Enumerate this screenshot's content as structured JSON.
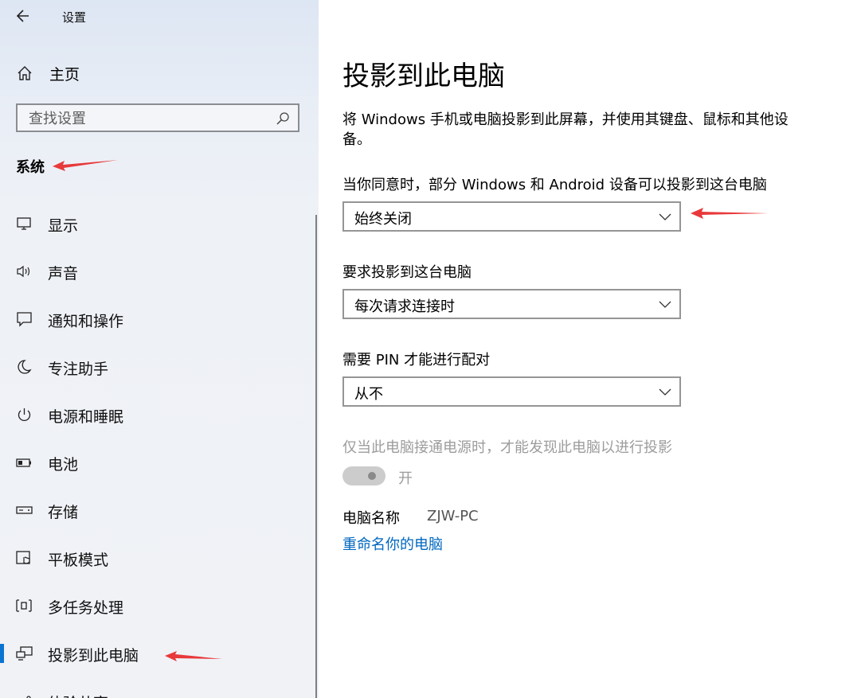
{
  "window": {
    "title": "设置"
  },
  "sidebar": {
    "home_label": "主页",
    "search_placeholder": "查找设置",
    "section_title": "系统",
    "items": [
      {
        "label": "显示",
        "icon": "monitor-icon"
      },
      {
        "label": "声音",
        "icon": "speaker-icon"
      },
      {
        "label": "通知和操作",
        "icon": "notification-icon"
      },
      {
        "label": "专注助手",
        "icon": "moon-icon"
      },
      {
        "label": "电源和睡眠",
        "icon": "power-icon"
      },
      {
        "label": "电池",
        "icon": "battery-icon"
      },
      {
        "label": "存储",
        "icon": "storage-icon"
      },
      {
        "label": "平板模式",
        "icon": "tablet-icon"
      },
      {
        "label": "多任务处理",
        "icon": "multitask-icon"
      },
      {
        "label": "投影到此电脑",
        "icon": "project-icon",
        "active": true
      },
      {
        "label": "体验共享",
        "icon": "share-icon"
      }
    ]
  },
  "main": {
    "title": "投影到此电脑",
    "description": "将 Windows 手机或电脑投影到此屏幕，并使用其键盘、鼠标和其他设备。",
    "settings": [
      {
        "label": "当你同意时，部分 Windows 和 Android 设备可以投影到这台电脑",
        "value": "始终关闭"
      },
      {
        "label": "要求投影到这台电脑",
        "value": "每次请求连接时"
      },
      {
        "label": "需要 PIN 才能进行配对",
        "value": "从不"
      }
    ],
    "power_setting": {
      "label": "仅当此电脑接通电源时，才能发现此电脑以进行投影",
      "toggle_text": "开",
      "enabled": false
    },
    "pc_name": {
      "label": "电脑名称",
      "value": "ZJW-PC"
    },
    "rename_link": "重命名你的电脑"
  },
  "colors": {
    "accent": "#0a74d0",
    "link": "#0067c0",
    "annotation_arrow": "#e8393b"
  }
}
